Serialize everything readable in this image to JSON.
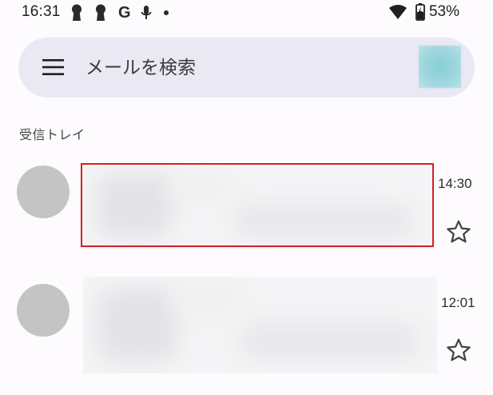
{
  "status_bar": {
    "time": "16:31",
    "google_glyph": "G",
    "battery_percent": "53%",
    "icons": [
      "keyhole-icon",
      "keyhole-icon",
      "google-icon",
      "mic-icon",
      "dot-icon",
      "wifi-icon",
      "battery-charging-icon"
    ]
  },
  "search": {
    "placeholder": "メールを検索",
    "menu_icon": "hamburger-menu-icon"
  },
  "section": {
    "title": "受信トレイ"
  },
  "emails": [
    {
      "time": "14:30",
      "starred": false,
      "content_blurred": true,
      "highlighted": true
    },
    {
      "time": "12:01",
      "starred": false,
      "content_blurred": true,
      "highlighted": false
    }
  ],
  "colors": {
    "background": "#fdfbfe",
    "search_bar": "#e9e8f3",
    "avatar_placeholder": "#c4c4c4",
    "account_avatar": "#87cfd8",
    "highlight": "#d32024"
  }
}
